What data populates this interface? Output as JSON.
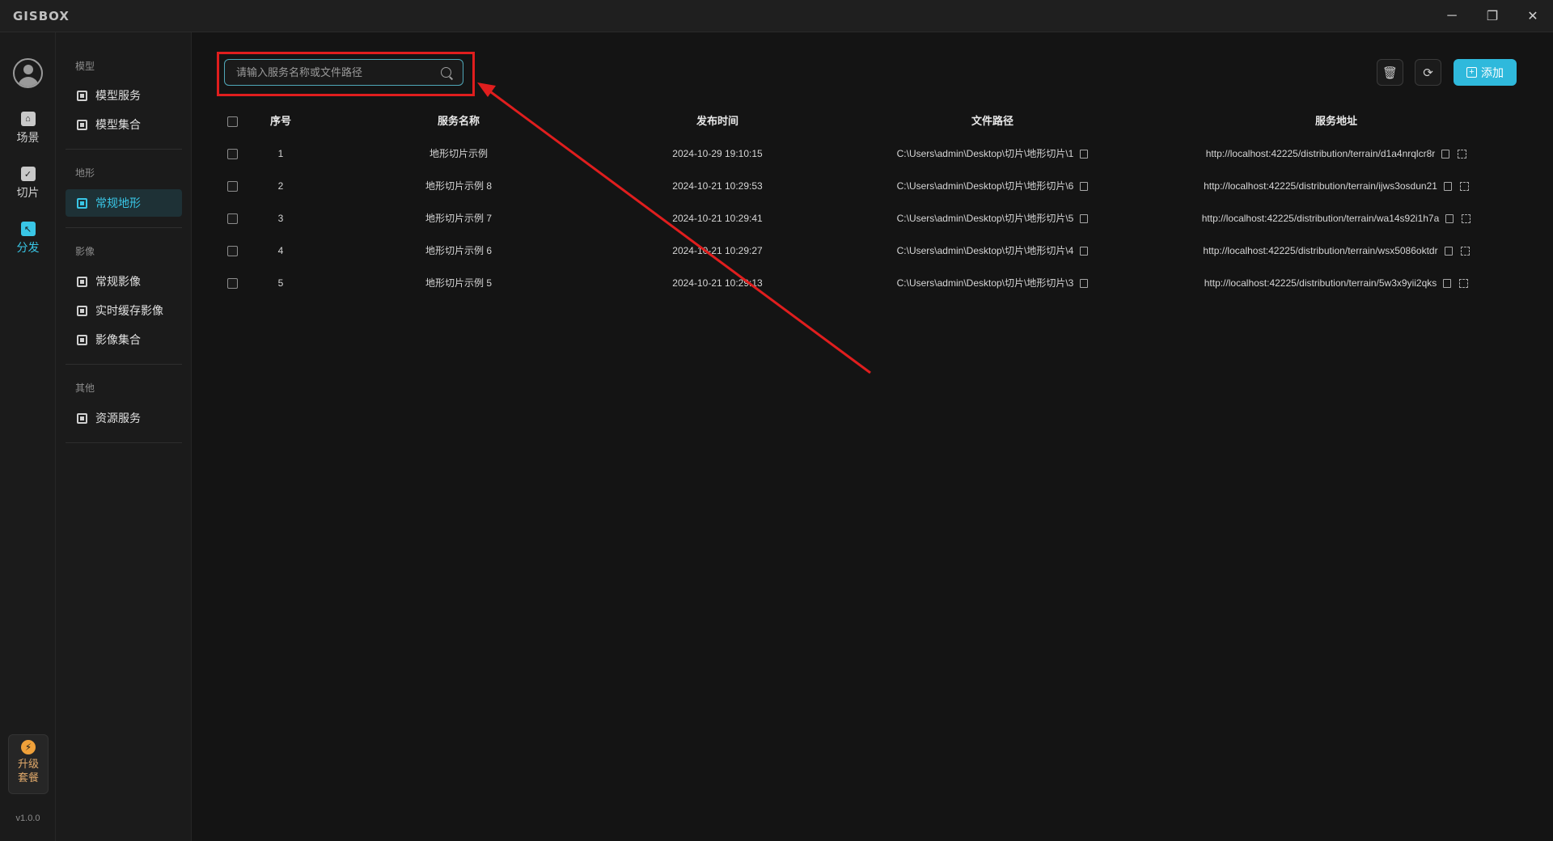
{
  "app": {
    "logo": "GISBOX",
    "window_controls": {
      "minimize": "─",
      "restore": "❐",
      "close": "✕"
    },
    "version": "v1.0.0"
  },
  "rail": {
    "items": [
      {
        "label": "场景",
        "icon": "scene-icon",
        "glyph": "⌂"
      },
      {
        "label": "切片",
        "icon": "slice-icon",
        "glyph": "✓"
      },
      {
        "label": "分发",
        "icon": "distribute-icon",
        "glyph": "↖",
        "active": true
      }
    ],
    "upgrade": {
      "glyph": "⚡",
      "label": "升级套餐"
    }
  },
  "sidebar": {
    "groups": [
      {
        "title": "模型",
        "items": [
          "模型服务",
          "模型集合"
        ]
      },
      {
        "title": "地形",
        "items": [
          "常规地形"
        ]
      },
      {
        "title": "影像",
        "items": [
          "常规影像",
          "实时缓存影像",
          "影像集合"
        ]
      },
      {
        "title": "其他",
        "items": [
          "资源服务"
        ]
      }
    ],
    "active_item": "常规地形"
  },
  "toolbar": {
    "search_placeholder": "请输入服务名称或文件路径",
    "delete_glyph": "🗑",
    "refresh_glyph": "⟳",
    "add_label": "添加",
    "add_glyph": "+"
  },
  "table": {
    "headers": {
      "index": "序号",
      "name": "服务名称",
      "time": "发布时间",
      "path": "文件路径",
      "address": "服务地址"
    },
    "rows": [
      {
        "index": "1",
        "name": "地形切片示例",
        "time": "2024-10-29 19:10:15",
        "path": "C:\\Users\\admin\\Desktop\\切片\\地形切片\\1",
        "address": "http://localhost:42225/distribution/terrain/d1a4nrqlcr8r"
      },
      {
        "index": "2",
        "name": "地形切片示例 8",
        "time": "2024-10-21 10:29:53",
        "path": "C:\\Users\\admin\\Desktop\\切片\\地形切片\\6",
        "address": "http://localhost:42225/distribution/terrain/ijws3osdun21"
      },
      {
        "index": "3",
        "name": "地形切片示例 7",
        "time": "2024-10-21 10:29:41",
        "path": "C:\\Users\\admin\\Desktop\\切片\\地形切片\\5",
        "address": "http://localhost:42225/distribution/terrain/wa14s92i1h7a"
      },
      {
        "index": "4",
        "name": "地形切片示例 6",
        "time": "2024-10-21 10:29:27",
        "path": "C:\\Users\\admin\\Desktop\\切片\\地形切片\\4",
        "address": "http://localhost:42225/distribution/terrain/wsx5086oktdr"
      },
      {
        "index": "5",
        "name": "地形切片示例 5",
        "time": "2024-10-21 10:29:13",
        "path": "C:\\Users\\admin\\Desktop\\切片\\地形切片\\3",
        "address": "http://localhost:42225/distribution/terrain/5w3x9yii2qks"
      }
    ]
  },
  "annotation": {
    "color": "#e01e1e"
  },
  "colors": {
    "accent": "#39c6e6",
    "add_button": "#2fb9dc",
    "background": "#141414"
  }
}
